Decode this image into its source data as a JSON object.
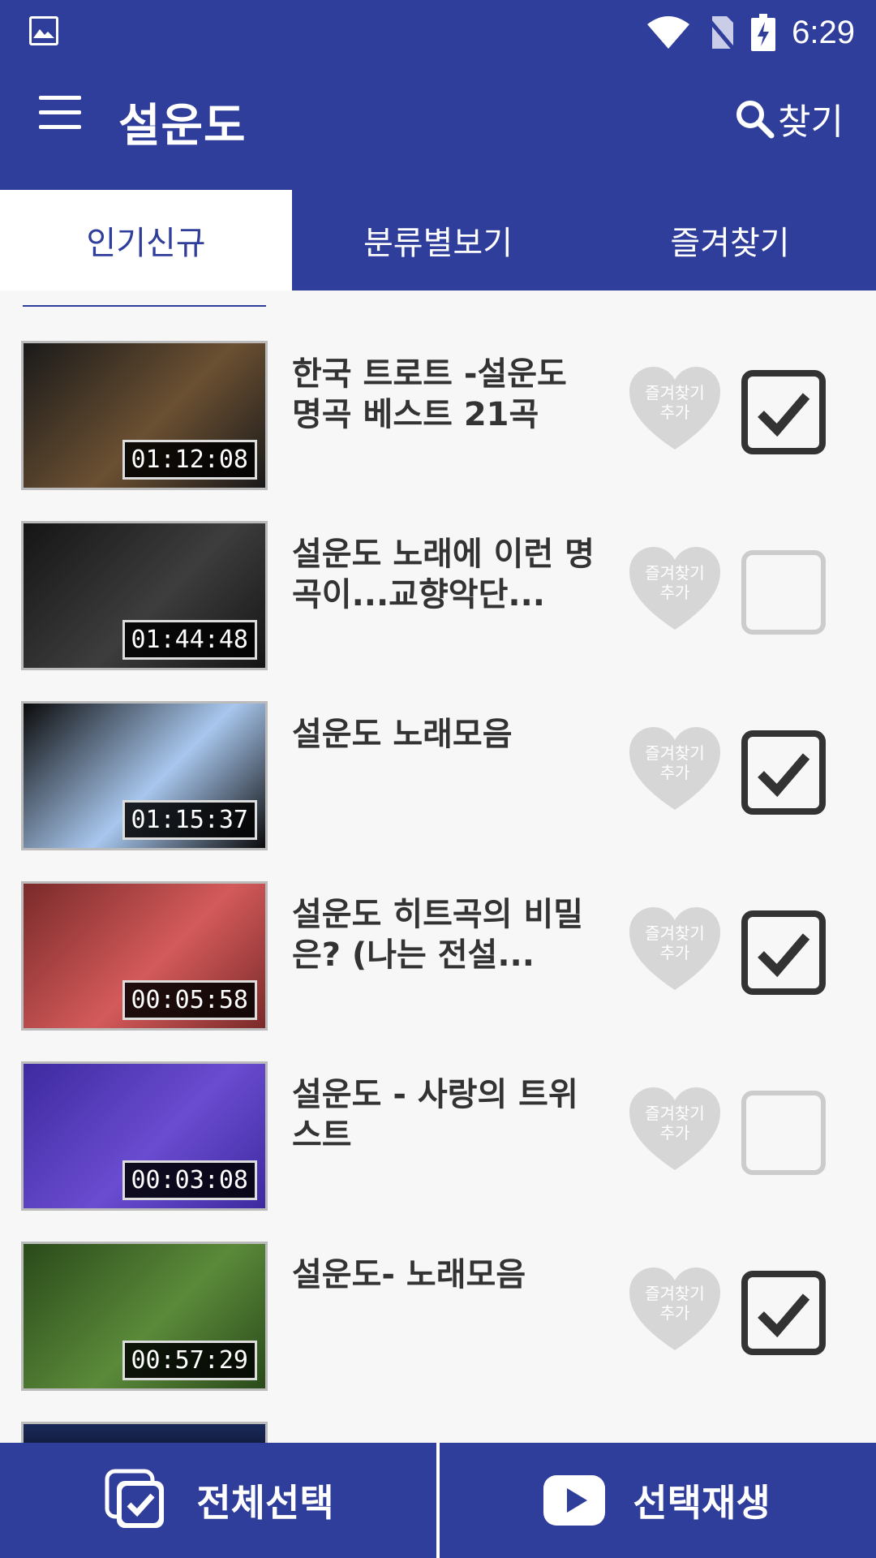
{
  "status_bar": {
    "time": "6:29"
  },
  "app_bar": {
    "title": "설운도",
    "search_label": "찾기"
  },
  "tabs": [
    {
      "label": "인기신규",
      "active": true
    },
    {
      "label": "분류별보기",
      "active": false
    },
    {
      "label": "즐겨찾기",
      "active": false
    }
  ],
  "favorite_label": {
    "line1": "즐겨찾기",
    "line2": "추가"
  },
  "items": [
    {
      "title": "한국 트로트 -설운도 명곡 베스트 21곡",
      "duration": "01:12:08",
      "checked": true,
      "thumb_colors": [
        "#1a1a1a",
        "#6b5032"
      ]
    },
    {
      "title": "설운도 노래에 이런 명곡이...교향악단...",
      "duration": "01:44:48",
      "checked": false,
      "thumb_colors": [
        "#151515",
        "#3d3d3d"
      ]
    },
    {
      "title": "설운도 노래모음",
      "duration": "01:15:37",
      "checked": true,
      "thumb_colors": [
        "#0b0b0b",
        "#a8c7ee"
      ]
    },
    {
      "title": "설운도 히트곡의 비밀은? (나는 전설...",
      "duration": "00:05:58",
      "checked": true,
      "thumb_colors": [
        "#7a2a2a",
        "#d45a5a"
      ]
    },
    {
      "title": "설운도 - 사랑의 트위스트",
      "duration": "00:03:08",
      "checked": false,
      "thumb_colors": [
        "#3e2aa0",
        "#6a4cd0"
      ]
    },
    {
      "title": "설운도- 노래모음",
      "duration": "00:57:29",
      "checked": true,
      "thumb_colors": [
        "#2a4a1a",
        "#5b8a3a"
      ]
    }
  ],
  "bottom_bar": {
    "select_all": "전체선택",
    "play_selected": "선택재생"
  },
  "colors": {
    "primary": "#2f3d9b",
    "heart": "#d6d6d6"
  }
}
